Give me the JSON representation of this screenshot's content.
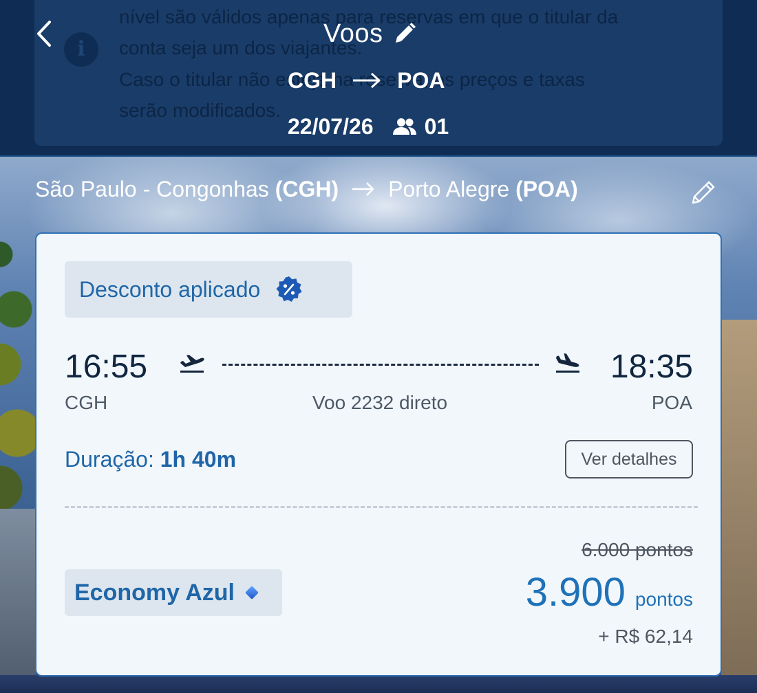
{
  "header": {
    "title": "Voos",
    "origin": "CGH",
    "destination": "POA",
    "date": "22/07/26",
    "passengers": "01",
    "behind_notice": {
      "line1": "nível são válidos apenas para reservas em que o titular da",
      "line2": "conta seja um dos viajantes.",
      "line3": "Caso o titular não esteja na reserva, os preços e taxas",
      "line4": "serão modificados."
    }
  },
  "section": {
    "origin_city": "São Paulo - Congonhas",
    "origin_code": "(CGH)",
    "destination_city": "Porto Alegre",
    "destination_code": "(POA)"
  },
  "card": {
    "discount_label": "Desconto aplicado",
    "departure_time": "16:55",
    "arrival_time": "18:35",
    "departure_code": "CGH",
    "arrival_code": "POA",
    "flight_info": "Voo 2232 direto",
    "duration_label": "Duração:",
    "duration_value": "1h 40m",
    "details_button": "Ver detalhes",
    "old_price": "6.000 pontos",
    "fare_class": "Economy Azul",
    "price_value": "3.900",
    "price_unit": "pontos",
    "price_tax": "+ R$ 62,14"
  },
  "icons": {
    "back": "chevron-left-icon",
    "edit_title": "pencil-icon",
    "route_arrow": "arrow-right-icon",
    "passengers": "people-icon",
    "discount": "discount-badge-icon",
    "takeoff": "airplane-takeoff-icon",
    "landing": "airplane-landing-icon",
    "fare": "diamond-icon",
    "edit_route": "pencil-outline-icon",
    "info": "info-icon"
  },
  "colors": {
    "header_bg": "#0f2d54",
    "accent_blue": "#1f66a8",
    "card_bg": "#f2f7fb",
    "card_border": "#2f6fb4"
  }
}
